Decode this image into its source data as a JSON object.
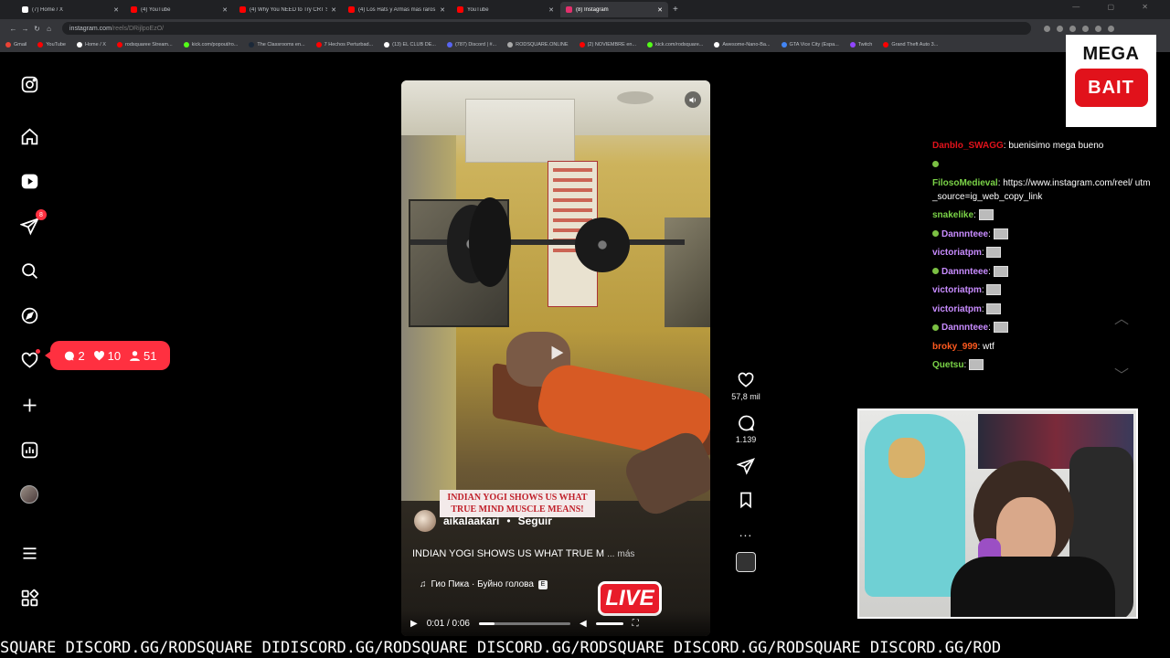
{
  "browser": {
    "tabs": [
      {
        "title": "(7) Home / X",
        "color": "#ffffff",
        "active": false
      },
      {
        "title": "(4) YouTube",
        "color": "#ff0000",
        "active": false
      },
      {
        "title": "(4) Why You NEED to Try CRT S",
        "color": "#ff0000",
        "active": false
      },
      {
        "title": "(4) Los Hats y Armas mas raros",
        "color": "#ff0000",
        "active": false
      },
      {
        "title": "YouTube",
        "color": "#ff0000",
        "active": false
      },
      {
        "title": "(8) Instagram",
        "color": "#e1306c",
        "active": true
      }
    ],
    "new_tab": "+",
    "url_host": "instagram.com",
    "url_path": "/reels/DRijlpoEzO/",
    "bookmarks": [
      {
        "label": "Gmail",
        "color": "#ea4335"
      },
      {
        "label": "YouTube",
        "color": "#ff0000"
      },
      {
        "label": "Home / X",
        "color": "#ffffff"
      },
      {
        "label": "rodsquaree Stream...",
        "color": "#ff0000"
      },
      {
        "label": "kick.com/popout/ro...",
        "color": "#53fc18"
      },
      {
        "label": "The Classrooms en...",
        "color": "#1b2838"
      },
      {
        "label": "7 Hechos Perturbad...",
        "color": "#ff0000"
      },
      {
        "label": "(13) EL CLUB DE...",
        "color": "#ffffff"
      },
      {
        "label": "(787) Discord | #...",
        "color": "#5865f2"
      },
      {
        "label": "RODSQUARE.ONLINE",
        "color": "#aaaaaa"
      },
      {
        "label": "(2) NOVIEMBRE en...",
        "color": "#ff0000"
      },
      {
        "label": "kick.com/rodsquare...",
        "color": "#53fc18"
      },
      {
        "label": "Awesome-Nano-Ba...",
        "color": "#ffffff"
      },
      {
        "label": "GTA Vice City (Espa...",
        "color": "#4285f4"
      },
      {
        "label": "Twitch",
        "color": "#9146ff"
      },
      {
        "label": "Grand Theft Auto 3...",
        "color": "#ff0000"
      }
    ]
  },
  "sidebar": {
    "messages_badge": "8"
  },
  "notification": {
    "comments": "2",
    "likes": "10",
    "follows": "51"
  },
  "reel": {
    "overlay_text": "INDIAN YOGI SHOWS US WHAT TRUE MIND MUSCLE MEANS!",
    "author": "aikalaakari",
    "separator": "•",
    "follow_label": "Seguir",
    "caption": "INDIAN YOGI SHOWS US WHAT TRUE M",
    "caption_ellipsis": "...",
    "more_label": "más",
    "audio": "Гио Пика · Буйно голова",
    "explicit": "E",
    "live_badge": "LIVE",
    "time": "0:01 / 0:06",
    "progress": 0.17
  },
  "actions": {
    "likes": "57,8 mil",
    "comments": "1.139",
    "more": "..."
  },
  "megabait": {
    "line1": "MEGA",
    "line2": "BAIT"
  },
  "chat": [
    {
      "user": "Danblo_SWAGG",
      "color": "#e1121b",
      "text": "buenisimo mega bueno",
      "emote": false,
      "wrap": false,
      "badge": false
    },
    {
      "user": "",
      "color": "#7bc043",
      "text": "",
      "emote": false,
      "wrap": false,
      "badge": true
    },
    {
      "user": "FilosoMedieval",
      "color": "#7bd448",
      "text": "https://www.instagram.com/reel/ utm_source=ig_web_copy_link",
      "emote": false,
      "wrap": true,
      "badge": false
    },
    {
      "user": "snakelike",
      "color": "#7bd448",
      "text": "",
      "emote": true,
      "wrap": false,
      "badge": false
    },
    {
      "user": "Dannnteee",
      "color": "#c88cff",
      "text": "",
      "emote": true,
      "wrap": false,
      "badge": true
    },
    {
      "user": "victoriatpm",
      "color": "#c88cff",
      "text": "",
      "emote": true,
      "wrap": false,
      "badge": false
    },
    {
      "user": "Dannnteee",
      "color": "#c88cff",
      "text": "",
      "emote": true,
      "wrap": false,
      "badge": true
    },
    {
      "user": "victoriatpm",
      "color": "#c88cff",
      "text": "",
      "emote": true,
      "wrap": false,
      "badge": false
    },
    {
      "user": "victoriatpm",
      "color": "#c88cff",
      "text": "",
      "emote": true,
      "wrap": false,
      "badge": false
    },
    {
      "user": "Dannnteee",
      "color": "#c88cff",
      "text": "",
      "emote": true,
      "wrap": false,
      "badge": true
    },
    {
      "user": "broky_999",
      "color": "#ff5a1f",
      "text": "wtf",
      "emote": false,
      "wrap": false,
      "badge": false
    },
    {
      "user": "Quetsu",
      "color": "#7bd448",
      "text": "",
      "emote": true,
      "wrap": false,
      "badge": false
    }
  ],
  "ticker": "SQUARE DISCORD.GG/RODSQUARE DIDISCORD.GG/RODSQUARE DISCORD.GG/RODSQUARE DISCORD.GG/RODSQUARE DISCORD.GG/ROD"
}
